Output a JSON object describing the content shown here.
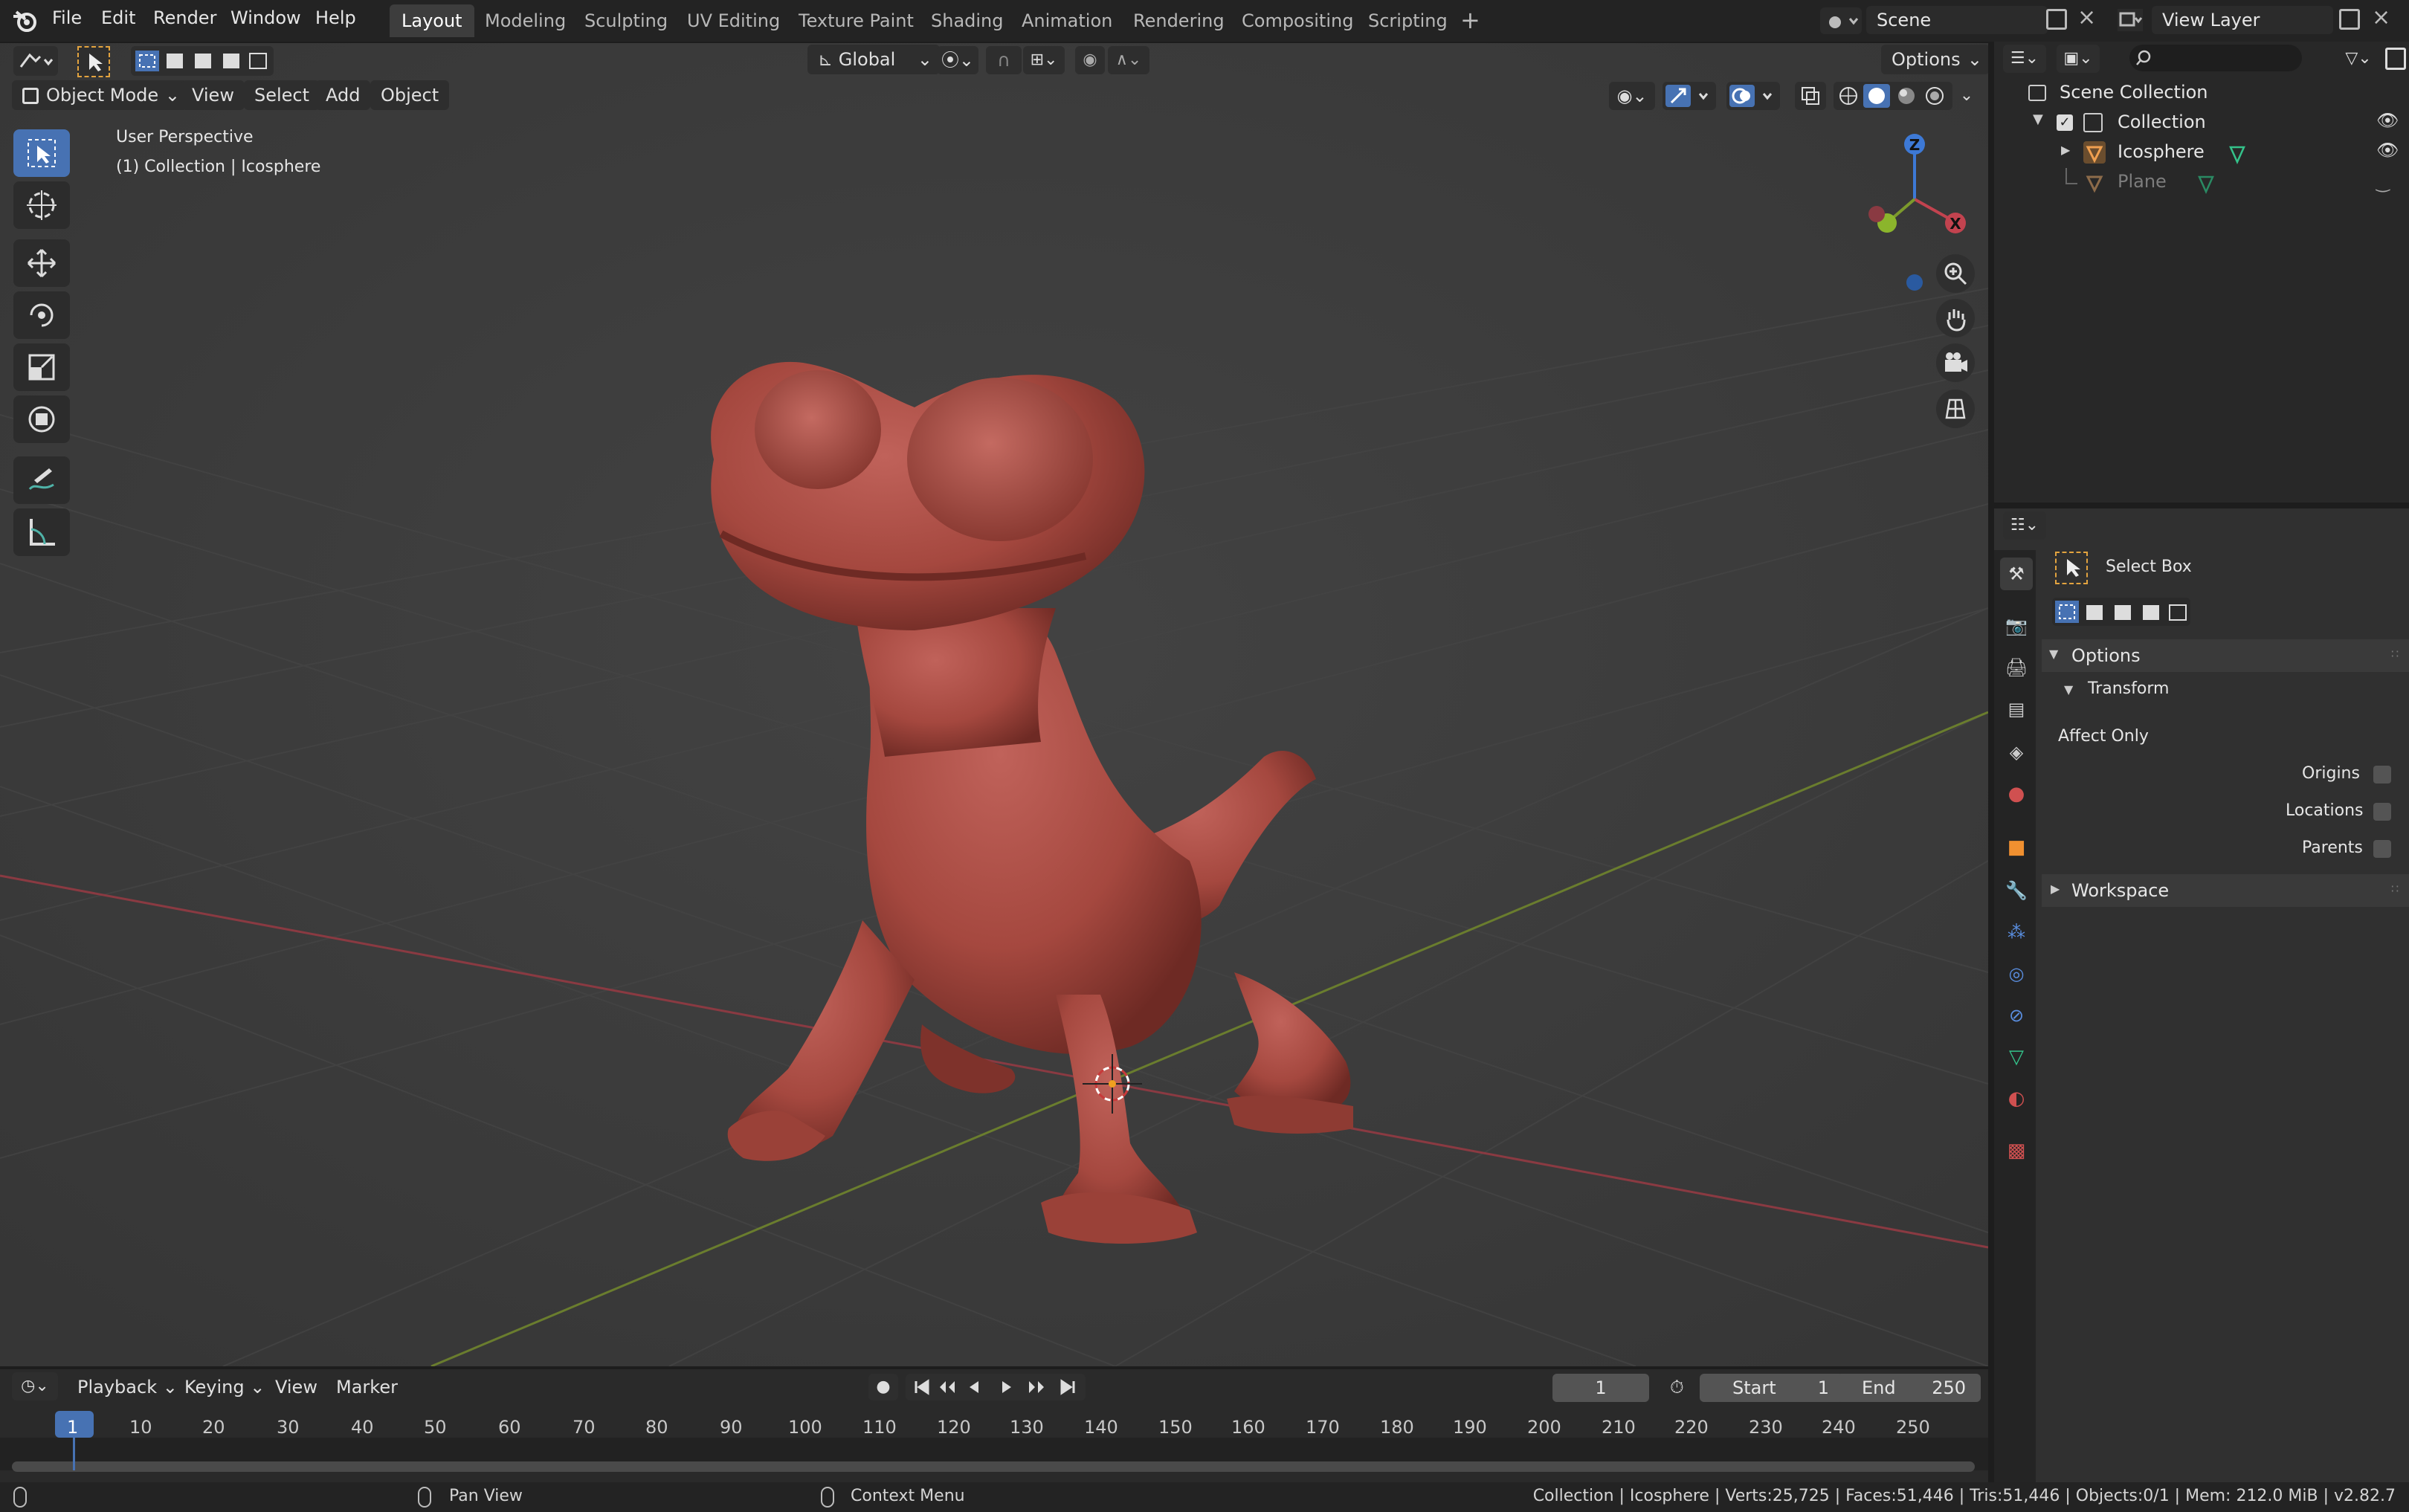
{
  "menus": [
    "File",
    "Edit",
    "Render",
    "Window",
    "Help"
  ],
  "workspace_tabs": [
    "Layout",
    "Modeling",
    "Sculpting",
    "UV Editing",
    "Texture Paint",
    "Shading",
    "Animation",
    "Rendering",
    "Compositing",
    "Scripting"
  ],
  "active_tab": "Layout",
  "scene": {
    "label": "Scene"
  },
  "view_layer": {
    "label": "View Layer"
  },
  "viewport": {
    "transform_orientation": "Global",
    "options_label": "Options",
    "mode": "Object Mode",
    "header_menus": [
      "View",
      "Select",
      "Add",
      "Object"
    ],
    "overlay_line1": "User Perspective",
    "overlay_line2": "(1) Collection | Icosphere",
    "gizmo": {
      "z": "Z",
      "x": "X"
    }
  },
  "outliner": {
    "scene_collection": "Scene Collection",
    "collection": "Collection",
    "objects": [
      "Icosphere",
      "Plane"
    ]
  },
  "properties": {
    "tool_name": "Select Box",
    "options_panel": "Options",
    "transform_sub": "Transform",
    "affect_only": "Affect Only",
    "checkboxes": [
      "Origins",
      "Locations",
      "Parents"
    ],
    "workspace_panel": "Workspace"
  },
  "timeline": {
    "menus": [
      "Playback",
      "Keying",
      "View",
      "Marker"
    ],
    "current_frame": "1",
    "start_label": "Start",
    "start_value": "1",
    "end_label": "End",
    "end_value": "250",
    "ruler": [
      "1",
      "10",
      "20",
      "30",
      "40",
      "50",
      "60",
      "70",
      "80",
      "90",
      "100",
      "110",
      "120",
      "130",
      "140",
      "150",
      "160",
      "170",
      "180",
      "190",
      "200",
      "210",
      "220",
      "230",
      "240",
      "250"
    ]
  },
  "statusbar": {
    "pan_view": "Pan View",
    "context_menu": "Context Menu",
    "stats": "Collection | Icosphere | Verts:25,725 | Faces:51,446 | Tris:51,446 | Objects:0/1 | Mem: 212.0 MiB | v2.82.7"
  },
  "colors": {
    "accent": "#4772b3",
    "model": "#a5483f",
    "x_axis": "#c2434f",
    "y_axis": "#7c9a2c"
  }
}
